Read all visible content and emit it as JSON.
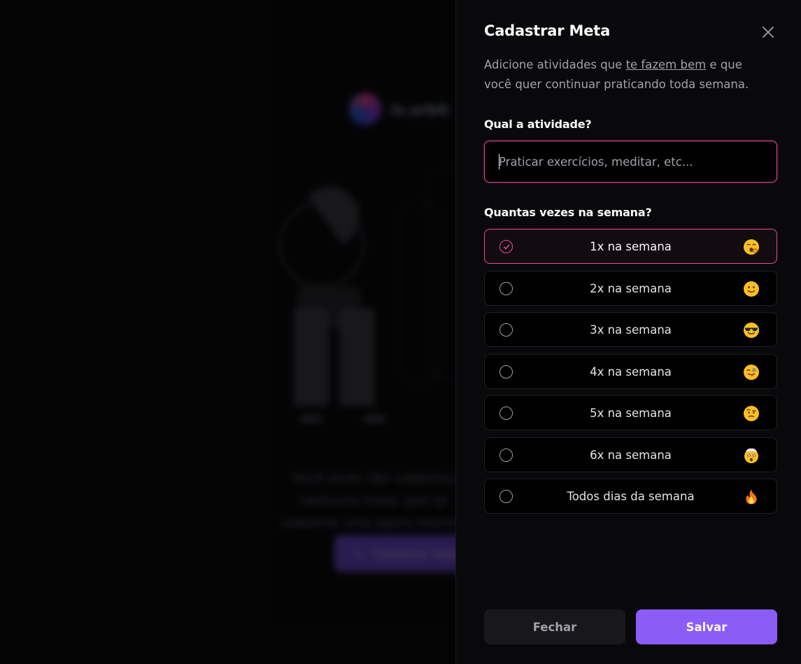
{
  "background": {
    "logo_text": "in.orbit",
    "empty_message": "Você ainda não cadastrou nenhuma meta, que tal cadastrar uma agora mesmo?",
    "cta_label": "Cadastrar meta",
    "cta_icon": "plus-icon"
  },
  "drawer": {
    "title": "Cadastrar Meta",
    "close_icon": "x-icon",
    "description_before": "Adicione atividades que ",
    "description_link": "te fazem bem",
    "description_after": " e que você quer continuar praticando toda semana.",
    "activity_label": "Qual a atividade?",
    "activity_value": "",
    "activity_placeholder": "Praticar exercícios, meditar, etc...",
    "frequency_label": "Quantas vezes na semana?",
    "options": [
      {
        "label": "1x na semana",
        "emoji": "🥱",
        "selected": true
      },
      {
        "label": "2x na semana",
        "emoji": "🙂",
        "selected": false
      },
      {
        "label": "3x na semana",
        "emoji": "😎",
        "selected": false
      },
      {
        "label": "4x na semana",
        "emoji": "😜",
        "selected": false
      },
      {
        "label": "5x na semana",
        "emoji": "🤨",
        "selected": false
      },
      {
        "label": "6x na semana",
        "emoji": "🤯",
        "selected": false
      },
      {
        "label": "Todos dias da semana",
        "emoji": "🔥",
        "selected": false
      }
    ],
    "close_button_label": "Fechar",
    "save_button_label": "Salvar"
  },
  "colors": {
    "accent_pink": "#ec4899",
    "primary_violet": "#8b5cf6",
    "panel_bg": "#09090b"
  }
}
